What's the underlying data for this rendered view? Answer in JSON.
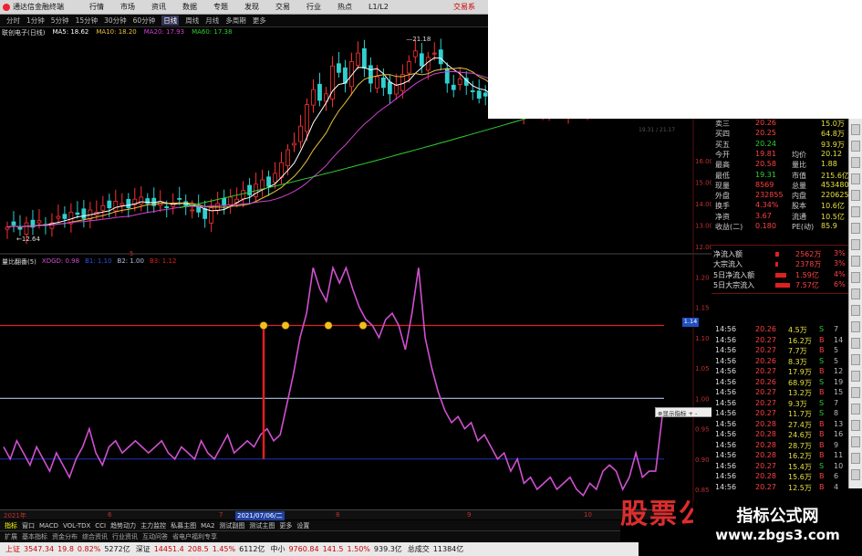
{
  "menubar": {
    "app": "通达信金融终端",
    "items": [
      "行情",
      "市场",
      "资讯",
      "数据",
      "专题",
      "发现",
      "交易",
      "行业",
      "热点",
      "L1/L2"
    ],
    "trade": "交易系"
  },
  "periods": [
    "分时",
    "1分钟",
    "5分钟",
    "15分钟",
    "30分钟",
    "60分钟",
    "日线",
    "周线",
    "月线",
    "多周期",
    "更多"
  ],
  "active_period": "日线",
  "kline_title": {
    "stock": "联创电子(日线)",
    "ma5": "MA5: 18.62",
    "ma10": "MA10: 18.20",
    "ma20": "MA20: 17.93",
    "ma60": "MA60: 17.38"
  },
  "kline_labels": {
    "high": "21.18",
    "low": "12.64",
    "mid_tag": "5",
    "avg_tag": "19.31 / 21.17"
  },
  "price_axis": [
    "16.00",
    "15.00",
    "14.00",
    "13.00",
    "12.00"
  ],
  "ind_axis": [
    "1.20",
    "1.15",
    "1.10",
    "1.05",
    "1.00",
    "0.95",
    "0.90",
    "0.85"
  ],
  "indicator_title": {
    "name": "量比翻番(5)",
    "xdgd": "XDGD: 0.98",
    "b1": "B1: 1.10",
    "b2": "B2: 1.00",
    "b3": "B3: 1.12"
  },
  "popup": "⊕显示指标 + -",
  "price_tag": "1.14",
  "quote": [
    {
      "l": "卖三",
      "v": "20.26",
      "r": "15.0万"
    },
    {
      "l": "买四",
      "v": "20.25",
      "r": "64.8万"
    },
    {
      "l": "买五",
      "v": "20.24",
      "r": "93.9万"
    },
    {
      "l": "今开",
      "v": "19.81",
      "l2": "均价",
      "r": "20.12"
    },
    {
      "l": "最高",
      "v": "20.58",
      "l2": "量比",
      "r": "1.88"
    },
    {
      "l": "最低",
      "v": "19.31",
      "l2": "市值",
      "r": "215.6亿"
    },
    {
      "l": "现量",
      "v": "8569",
      "l2": "总量",
      "r": "453480"
    },
    {
      "l": "外盘",
      "v": "232855",
      "l2": "内盘",
      "r": "220625"
    },
    {
      "l": "换手",
      "v": "4.34%",
      "l2": "股本",
      "r": "10.6亿"
    },
    {
      "l": "净资",
      "v": "3.67",
      "l2": "流通",
      "r": "10.5亿"
    },
    {
      "l": "收益(二)",
      "v": "0.180",
      "l2": "PE(动)",
      "r": "85.9"
    }
  ],
  "flow": [
    {
      "l": "净流入额",
      "v": "2562万",
      "p": "3%"
    },
    {
      "l": "大宗流入",
      "v": "2378万",
      "p": "3%"
    },
    {
      "l": "5日净流入额",
      "v": "1.59亿",
      "p": "4%"
    },
    {
      "l": "5日大宗流入",
      "v": "7.57亿",
      "p": "6%"
    }
  ],
  "ticks": [
    {
      "t": "14:56",
      "p": "20.26",
      "v": "4.5万",
      "d": "S",
      "n": "7"
    },
    {
      "t": "14:56",
      "p": "20.27",
      "v": "16.2万",
      "d": "B",
      "n": "14"
    },
    {
      "t": "14:56",
      "p": "20.27",
      "v": "7.7万",
      "d": "B",
      "n": "5"
    },
    {
      "t": "14:56",
      "p": "20.26",
      "v": "8.3万",
      "d": "S",
      "n": "5"
    },
    {
      "t": "14:56",
      "p": "20.27",
      "v": "17.9万",
      "d": "B",
      "n": "12"
    },
    {
      "t": "14:56",
      "p": "20.26",
      "v": "68.9万",
      "d": "S",
      "n": "19"
    },
    {
      "t": "14:56",
      "p": "20.27",
      "v": "13.2万",
      "d": "B",
      "n": "15"
    },
    {
      "t": "14:56",
      "p": "20.27",
      "v": "9.3万",
      "d": "S",
      "n": "7"
    },
    {
      "t": "14:56",
      "p": "20.27",
      "v": "11.7万",
      "d": "S",
      "n": "8"
    },
    {
      "t": "14:56",
      "p": "20.28",
      "v": "27.4万",
      "d": "B",
      "n": "13"
    },
    {
      "t": "14:56",
      "p": "20.28",
      "v": "24.6万",
      "d": "B",
      "n": "16"
    },
    {
      "t": "14:56",
      "p": "20.28",
      "v": "28.7万",
      "d": "B",
      "n": "9"
    },
    {
      "t": "14:56",
      "p": "20.28",
      "v": "16.2万",
      "d": "B",
      "n": "11"
    },
    {
      "t": "14:56",
      "p": "20.27",
      "v": "15.4万",
      "d": "S",
      "n": "10"
    },
    {
      "t": "14:56",
      "p": "20.28",
      "v": "15.6万",
      "d": "B",
      "n": "6"
    },
    {
      "t": "14:56",
      "p": "20.27",
      "v": "12.5万",
      "d": "B",
      "n": "4"
    }
  ],
  "datebar": [
    "2021年",
    "6",
    "7",
    "2021/07/06/二",
    "8",
    "9",
    "10"
  ],
  "tabs1": [
    "指标",
    "窗口",
    "MACD",
    "VOL-TDX",
    "CCI",
    "趋势动力",
    "主力监控",
    "私募主图",
    "MA2",
    "测试副图",
    "测试主图",
    "更多",
    "设置"
  ],
  "tabs2": [
    "扩展",
    "基本指标",
    "资金分布",
    "综合资讯",
    "行业资讯",
    "互动问答",
    "省电户福利专享"
  ],
  "status": {
    "sh_label": "上证",
    "sh_val": "3547.34",
    "sh_chg": "19.8",
    "sh_pct": "0.82%",
    "sh_amt": "5272亿",
    "sz_label": "深证",
    "sz_val": "14451.4",
    "sz_chg": "208.5",
    "sz_pct": "1.45%",
    "sz_amt": "6112亿",
    "zx_label": "中小",
    "zx_val": "9760.84",
    "zx_chg": "141.5",
    "zx_pct": "1.50%",
    "zx_amt": "939.3亿",
    "total": "总成交",
    "total_amt": "11384亿"
  },
  "watermark": {
    "red": "股票公式网",
    "box_line1": "指标公式网",
    "box_line2": "www.zbgs3.com"
  },
  "colors": {
    "up": "#ff3030",
    "down": "#30d0d0",
    "ma5": "#ffffff",
    "ma10": "#e8c040",
    "ma20": "#d040d0",
    "ma60": "#30d030",
    "indicator": "#d050d0",
    "red_line": "#e02020",
    "white_line": "#b0c0e0",
    "blue_line": "#2030c0"
  }
}
